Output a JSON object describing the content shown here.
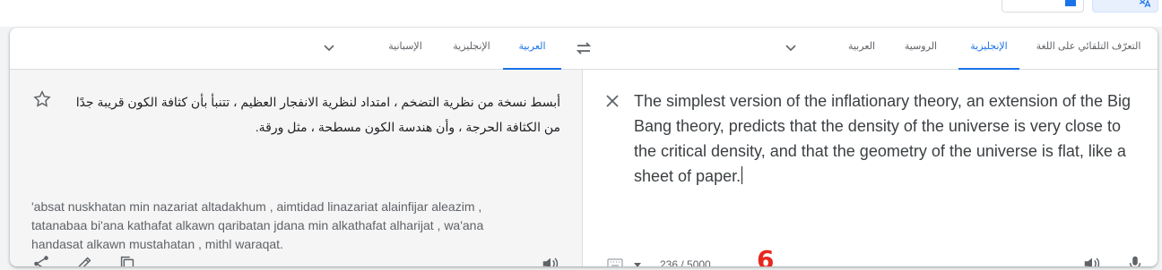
{
  "top_strip": {
    "icons": [
      "square-icon",
      "translate-icon"
    ]
  },
  "source_languages": {
    "tabs": [
      "التعرّف التلقائي على اللغة",
      "الإنجليزية",
      "الروسية",
      "العربية"
    ],
    "active_index": 1
  },
  "target_languages": {
    "tabs": [
      "العربية",
      "الإنجليزية",
      "الإسبانية"
    ],
    "active_index": 0
  },
  "source": {
    "text": "The simplest version of the inflationary theory, an extension of the Big Bang theory, predicts that the density of the universe is very close to the critical density, and that the geometry of the universe is flat, like a sheet of paper.",
    "char_count": "236 / 5000",
    "annotation": "6",
    "annotation_color": "#e8271f"
  },
  "translation": {
    "text": "أبسط نسخة من نظرية التضخم ، امتداد لنظرية الانفجار العظيم ، تتنبأ بأن كثافة الكون قريبة جدًا من الكثافة الحرجة ، وأن هندسة الكون مسطحة ، مثل ورقة.",
    "transliteration": "'absat nuskhatan min nazariat altadakhum , aimtidad linazariat alainfijar aleazim , tatanabaa bi'ana kathafat alkawn qaribatan jdana min alkathafat alharijat , wa'ana handasat alkawn mustahatan , mithl waraqat."
  },
  "colors": {
    "accent": "#1a73e8",
    "text": "#202124",
    "muted": "#5f6368",
    "panel": "#f5f5f5"
  }
}
